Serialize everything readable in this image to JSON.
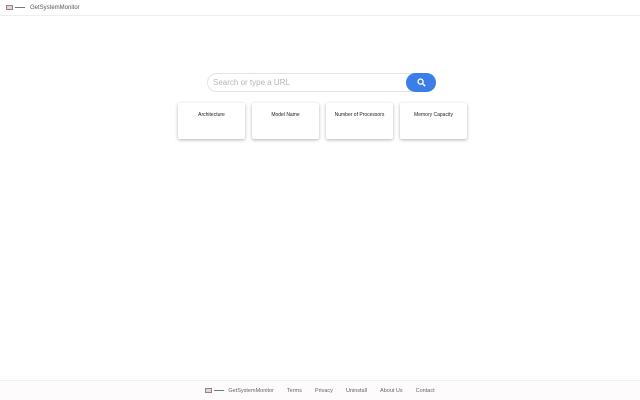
{
  "header": {
    "brand": "GetSystemMonitor"
  },
  "search": {
    "placeholder": "Search or type a URL"
  },
  "cards": [
    {
      "label": "Architecture"
    },
    {
      "label": "Model Name"
    },
    {
      "label": "Number of Processors"
    },
    {
      "label": "Memory Capacity"
    }
  ],
  "footer": {
    "brand": "GetSystemMonitor",
    "links": [
      "Terms",
      "Privacy",
      "Uninstall",
      "About Us",
      "Contact"
    ]
  },
  "colors": {
    "accent": "#3c7ee8"
  }
}
